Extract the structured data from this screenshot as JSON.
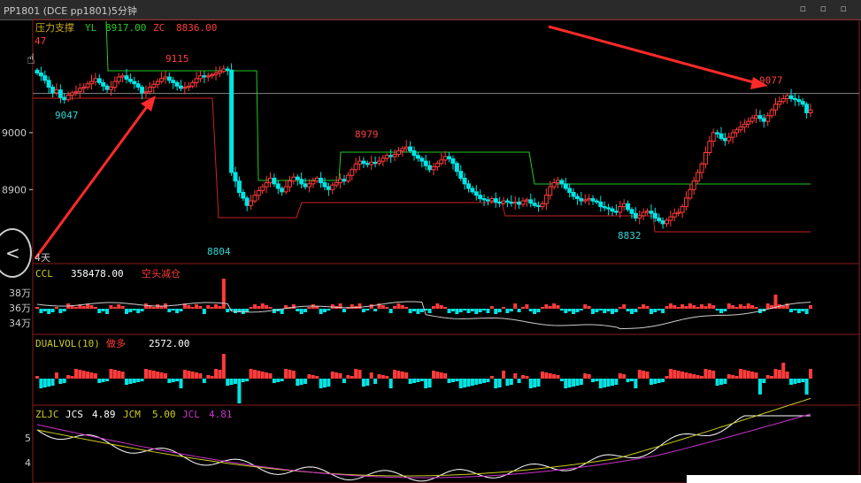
{
  "window": {
    "title": "PP1801  (DCE pp1801)5分钟",
    "controls": "▫ ▫ ▫"
  },
  "main_panel": {
    "indicator_name": "压力支撑",
    "yl_label": "YL",
    "yl_value": "8917.00",
    "zc_label": "ZC",
    "zc_value": "8836.00",
    "corner_value": "47",
    "period_label": "4天"
  },
  "ccl_panel": {
    "name": "CCL",
    "value": "358478.00",
    "desc": "空头减仓"
  },
  "vol_panel": {
    "name": "DUALVOL(10)",
    "desc": "做多",
    "value": "2572.00"
  },
  "zljc_panel": {
    "name": "ZLJC",
    "jcs_label": "JCS",
    "jcs_value": "4.89",
    "jcm_label": "JCM",
    "jcm_value": "5.00",
    "jcl_label": "JCL",
    "jcl_value": "4.81"
  },
  "colors": {
    "up": "#ff3b3b",
    "down": "#00e5e5",
    "resistance": "#22cc22",
    "support": "#cc2222",
    "arrow": "#ff2a2a",
    "jcs": "#ffffff",
    "jcm": "#cccc22",
    "jcl": "#cc33cc",
    "panel_border": "#8b1a1a"
  },
  "chart_data": [
    {
      "type": "candlestick",
      "title": "PP1801  (DCE pp1801)5分钟",
      "ylim": [
        8790,
        9140
      ],
      "yticks": [
        9000,
        8900
      ],
      "annotations": [
        {
          "label": "9115",
          "price": 9115,
          "color": "#ff4040"
        },
        {
          "label": "9047",
          "price": 9047,
          "color": "#33d6d6"
        },
        {
          "label": "8979",
          "price": 8979,
          "color": "#ff4040"
        },
        {
          "label": "8804",
          "price": 8804,
          "color": "#33d6d6"
        },
        {
          "label": "8832",
          "price": 8832,
          "color": "#33d6d6"
        },
        {
          "label": "9077",
          "price": 9077,
          "color": "#ff4040"
        }
      ],
      "reference_line": 9069,
      "close_series": [
        9105,
        9100,
        9092,
        9080,
        9070,
        9075,
        9062,
        9058,
        9066,
        9070,
        9072,
        9078,
        9080,
        9086,
        9090,
        9095,
        9088,
        9082,
        9076,
        9080,
        9090,
        9098,
        9100,
        9094,
        9090,
        9086,
        9080,
        9070,
        9072,
        9080,
        9085,
        9090,
        9095,
        9098,
        9092,
        9088,
        9082,
        9078,
        9080,
        9082,
        9088,
        9095,
        9100,
        9098,
        9100,
        9102,
        9105,
        9108,
        9112,
        9110,
        8930,
        8915,
        8895,
        8885,
        8872,
        8880,
        8890,
        8898,
        8905,
        8912,
        8920,
        8910,
        8902,
        8896,
        8905,
        8915,
        8922,
        8918,
        8910,
        8905,
        8910,
        8915,
        8920,
        8912,
        8905,
        8900,
        8908,
        8912,
        8918,
        8915,
        8925,
        8935,
        8945,
        8950,
        8946,
        8944,
        8948,
        8946,
        8950,
        8955,
        8960,
        8958,
        8962,
        8968,
        8972,
        8975,
        8968,
        8960,
        8955,
        8950,
        8942,
        8935,
        8940,
        8946,
        8952,
        8958,
        8954,
        8946,
        8932,
        8920,
        8910,
        8902,
        8896,
        8890,
        8884,
        8882,
        8880,
        8884,
        8878,
        8876,
        8880,
        8878,
        8876,
        8878,
        8874,
        8880,
        8882,
        8876,
        8872,
        8870,
        8875,
        8890,
        8905,
        8912,
        8916,
        8910,
        8902,
        8895,
        8888,
        8884,
        8880,
        8882,
        8884,
        8880,
        8878,
        8870,
        8868,
        8866,
        8862,
        8860,
        8870,
        8875,
        8865,
        8858,
        8850,
        8854,
        8860,
        8862,
        8858,
        8850,
        8845,
        8840,
        8846,
        8852,
        8858,
        8860,
        8870,
        8885,
        8900,
        8915,
        8930,
        8945,
        8965,
        8985,
        9000,
        8998,
        8990,
        8986,
        8992,
        9000,
        9005,
        9010,
        9015,
        9020,
        9026,
        9030,
        9025,
        9020,
        9030,
        9040,
        9050,
        9055,
        9060,
        9065,
        9060,
        9058,
        9055,
        9050,
        9035,
        9040
      ]
    }
  ]
}
